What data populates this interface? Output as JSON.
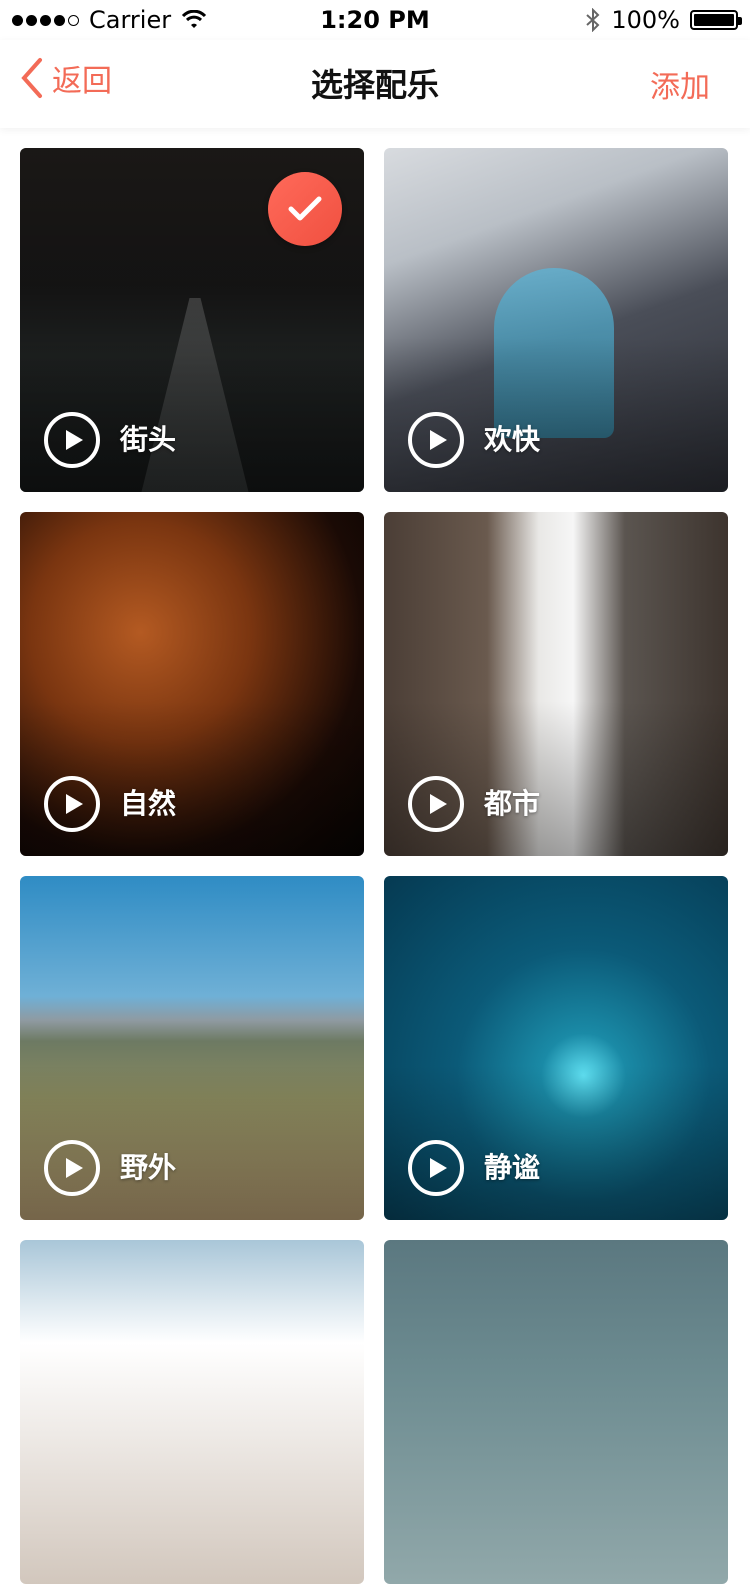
{
  "status_bar": {
    "carrier": "Carrier",
    "time": "1:20 PM",
    "battery": "100%",
    "signal_icon": "signal-dots-icon",
    "wifi_icon": "wifi-icon",
    "bluetooth_icon": "bluetooth-icon"
  },
  "nav": {
    "back_label": "返回",
    "title": "选择配乐",
    "add_label": "添加",
    "accent_color": "#f36b57"
  },
  "music": {
    "items": [
      {
        "label": "街头",
        "selected": true
      },
      {
        "label": "欢快",
        "selected": false
      },
      {
        "label": "自然",
        "selected": false
      },
      {
        "label": "都市",
        "selected": false
      },
      {
        "label": "野外",
        "selected": false
      },
      {
        "label": "静谧",
        "selected": false
      },
      {
        "label": "",
        "selected": false
      },
      {
        "label": "",
        "selected": false
      }
    ]
  }
}
